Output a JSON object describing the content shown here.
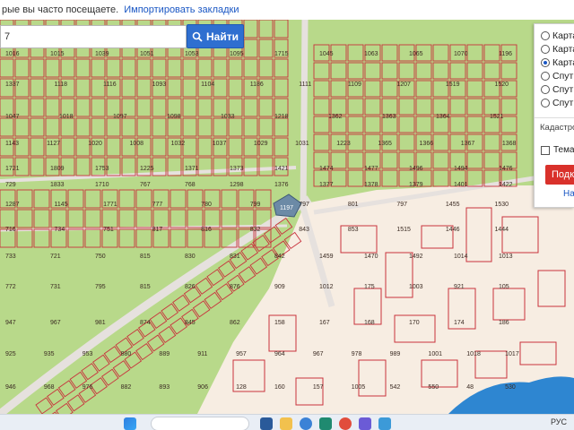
{
  "bookmarks_bar": {
    "text": "рые вы часто посещаете.",
    "import_link": "Импортировать закладки"
  },
  "search": {
    "value": "7",
    "button_label": "Найти"
  },
  "layers": {
    "options": [
      {
        "label": "Карта",
        "checked": false
      },
      {
        "label": "Карта",
        "checked": false
      },
      {
        "label": "Карта",
        "checked": true
      },
      {
        "label": "Спут",
        "checked": false
      },
      {
        "label": "Спут",
        "checked": false
      },
      {
        "label": "Спут",
        "checked": false
      }
    ],
    "cadastre_label": "Кадастро",
    "theme_label": "Темат",
    "apply_button": "Подк",
    "link": "На"
  },
  "map": {
    "colors": {
      "land": "#b8d98a",
      "parcel_border": "#c8323c",
      "road": "#e6e1de",
      "urban": "#f7ede2",
      "water": "#2e86d1",
      "selected": "#6c8aa6"
    },
    "labels": {
      "row1": [
        "1016",
        "1015",
        "1039",
        "1051",
        "1053",
        "1095",
        "1715",
        "1045",
        "1063",
        "1065",
        "1070",
        "1196"
      ],
      "row2": [
        "1337",
        "1118",
        "1116",
        "1093",
        "1104",
        "1186",
        "1111",
        "1109",
        "1207",
        "1519",
        "1520"
      ],
      "row3": [
        "1047",
        "1018",
        "1097",
        "1098",
        "1033",
        "1218",
        "1362",
        "1363",
        "1364",
        "1521"
      ],
      "row4": [
        "1143",
        "1127",
        "1020",
        "1008",
        "1032",
        "1037",
        "1029",
        "1031",
        "1223",
        "1365",
        "1366",
        "1367",
        "1368"
      ],
      "row5": [
        "1721",
        "1809",
        "1753",
        "1225",
        "1371",
        "1373",
        "1421",
        "1474",
        "1477",
        "1496",
        "1494",
        "1476"
      ],
      "row6": [
        "729",
        "1833",
        "1710",
        "767",
        "768",
        "1298",
        "1376",
        "1377",
        "1378",
        "1379",
        "1401",
        "1422"
      ],
      "row7": [
        "1287",
        "1145",
        "1771",
        "777",
        "780",
        "799",
        "797",
        "801",
        "797",
        "1455",
        "1530"
      ],
      "row8": [
        "716",
        "734",
        "751",
        "817",
        "816",
        "832",
        "843",
        "853",
        "1515",
        "1446",
        "1444"
      ],
      "row9": [
        "733",
        "721",
        "750",
        "815",
        "830",
        "831",
        "842",
        "1459",
        "1470",
        "1492",
        "1014",
        "1013"
      ],
      "row10": [
        "772",
        "731",
        "795",
        "815",
        "826",
        "876",
        "909",
        "1012",
        "175",
        "1003",
        "921",
        "105"
      ],
      "row11": [
        "947",
        "967",
        "981",
        "874",
        "845",
        "862",
        "158",
        "167",
        "168",
        "170",
        "174",
        "186"
      ],
      "row12": [
        "925",
        "935",
        "953",
        "880",
        "889",
        "911",
        "957",
        "964",
        "967",
        "978",
        "989",
        "1001",
        "1018",
        "1017"
      ],
      "row13": [
        "946",
        "968",
        "976",
        "882",
        "893",
        "906",
        "128",
        "160",
        "157",
        "1005",
        "542",
        "550",
        "48",
        "530"
      ]
    },
    "selected_label": "1197"
  },
  "taskbar": {
    "tray_text": "РУС"
  }
}
